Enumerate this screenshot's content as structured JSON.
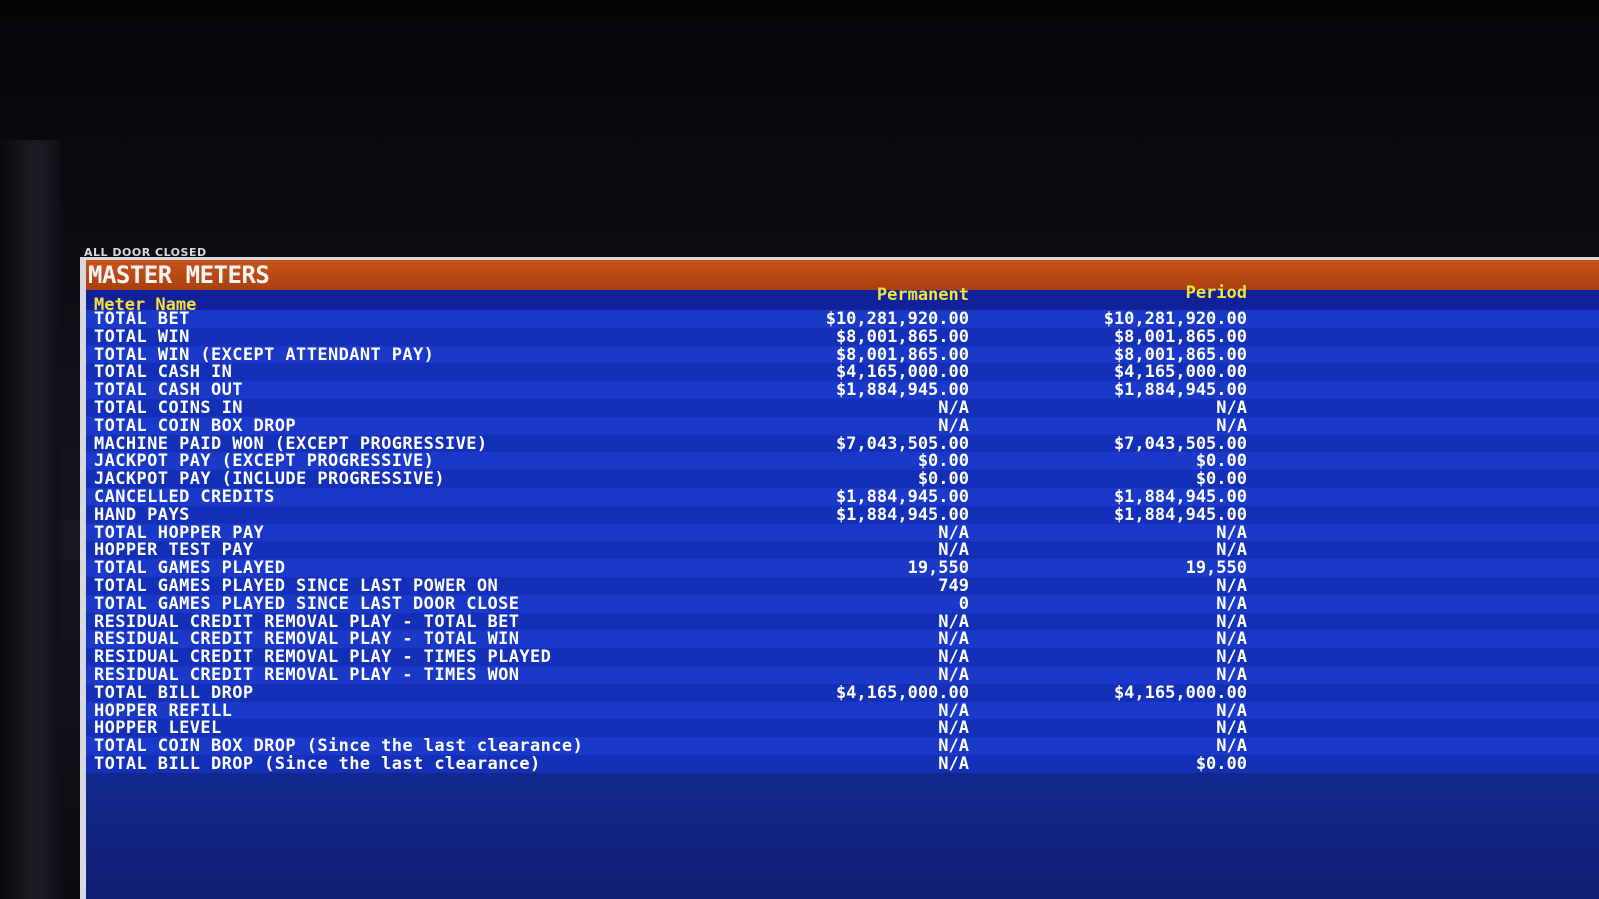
{
  "status": "ALL DOOR CLOSED",
  "title": "MASTER METERS",
  "columns": {
    "name": "Meter Name",
    "permanent": "Permanent",
    "period": "Period"
  },
  "rows": [
    {
      "name": "TOTAL BET",
      "permanent": "$10,281,920.00",
      "period": "$10,281,920.00"
    },
    {
      "name": "TOTAL WIN",
      "permanent": "$8,001,865.00",
      "period": "$8,001,865.00"
    },
    {
      "name": "TOTAL WIN (EXCEPT ATTENDANT PAY)",
      "permanent": "$8,001,865.00",
      "period": "$8,001,865.00"
    },
    {
      "name": "TOTAL CASH IN",
      "permanent": "$4,165,000.00",
      "period": "$4,165,000.00"
    },
    {
      "name": "TOTAL CASH OUT",
      "permanent": "$1,884,945.00",
      "period": "$1,884,945.00"
    },
    {
      "name": "TOTAL COINS IN",
      "permanent": "N/A",
      "period": "N/A"
    },
    {
      "name": "TOTAL COIN BOX DROP",
      "permanent": "N/A",
      "period": "N/A"
    },
    {
      "name": "MACHINE PAID WON (EXCEPT PROGRESSIVE)",
      "permanent": "$7,043,505.00",
      "period": "$7,043,505.00"
    },
    {
      "name": "JACKPOT PAY (EXCEPT PROGRESSIVE)",
      "permanent": "$0.00",
      "period": "$0.00"
    },
    {
      "name": "JACKPOT PAY (INCLUDE PROGRESSIVE)",
      "permanent": "$0.00",
      "period": "$0.00"
    },
    {
      "name": "CANCELLED CREDITS",
      "permanent": "$1,884,945.00",
      "period": "$1,884,945.00"
    },
    {
      "name": "HAND PAYS",
      "permanent": "$1,884,945.00",
      "period": "$1,884,945.00"
    },
    {
      "name": "TOTAL HOPPER PAY",
      "permanent": "N/A",
      "period": "N/A"
    },
    {
      "name": "HOPPER TEST PAY",
      "permanent": "N/A",
      "period": "N/A"
    },
    {
      "name": "TOTAL GAMES PLAYED",
      "permanent": "19,550",
      "period": "19,550"
    },
    {
      "name": "TOTAL GAMES PLAYED SINCE LAST POWER ON",
      "permanent": "749",
      "period": "N/A"
    },
    {
      "name": "TOTAL GAMES PLAYED SINCE LAST DOOR CLOSE",
      "permanent": "0",
      "period": "N/A"
    },
    {
      "name": "RESIDUAL CREDIT REMOVAL PLAY - TOTAL BET",
      "permanent": "N/A",
      "period": "N/A"
    },
    {
      "name": "RESIDUAL CREDIT REMOVAL PLAY - TOTAL WIN",
      "permanent": "N/A",
      "period": "N/A"
    },
    {
      "name": "RESIDUAL CREDIT REMOVAL PLAY - TIMES PLAYED",
      "permanent": "N/A",
      "period": "N/A"
    },
    {
      "name": "RESIDUAL CREDIT REMOVAL PLAY - TIMES WON",
      "permanent": "N/A",
      "period": "N/A"
    },
    {
      "name": "TOTAL BILL DROP",
      "permanent": "$4,165,000.00",
      "period": "$4,165,000.00"
    },
    {
      "name": "HOPPER REFILL",
      "permanent": "N/A",
      "period": "N/A"
    },
    {
      "name": "HOPPER LEVEL",
      "permanent": "N/A",
      "period": "N/A"
    },
    {
      "name": "TOTAL COIN BOX DROP (Since the last clearance)",
      "permanent": "N/A",
      "period": "N/A"
    },
    {
      "name": "TOTAL BILL DROP (Since the last clearance)",
      "permanent": "N/A",
      "period": "$0.00"
    }
  ],
  "colors": {
    "screen_blue": "#1a39c9",
    "title_orange": "#c9541c",
    "header_yellow": "#f4e23a",
    "text_white": "#ffffff"
  }
}
